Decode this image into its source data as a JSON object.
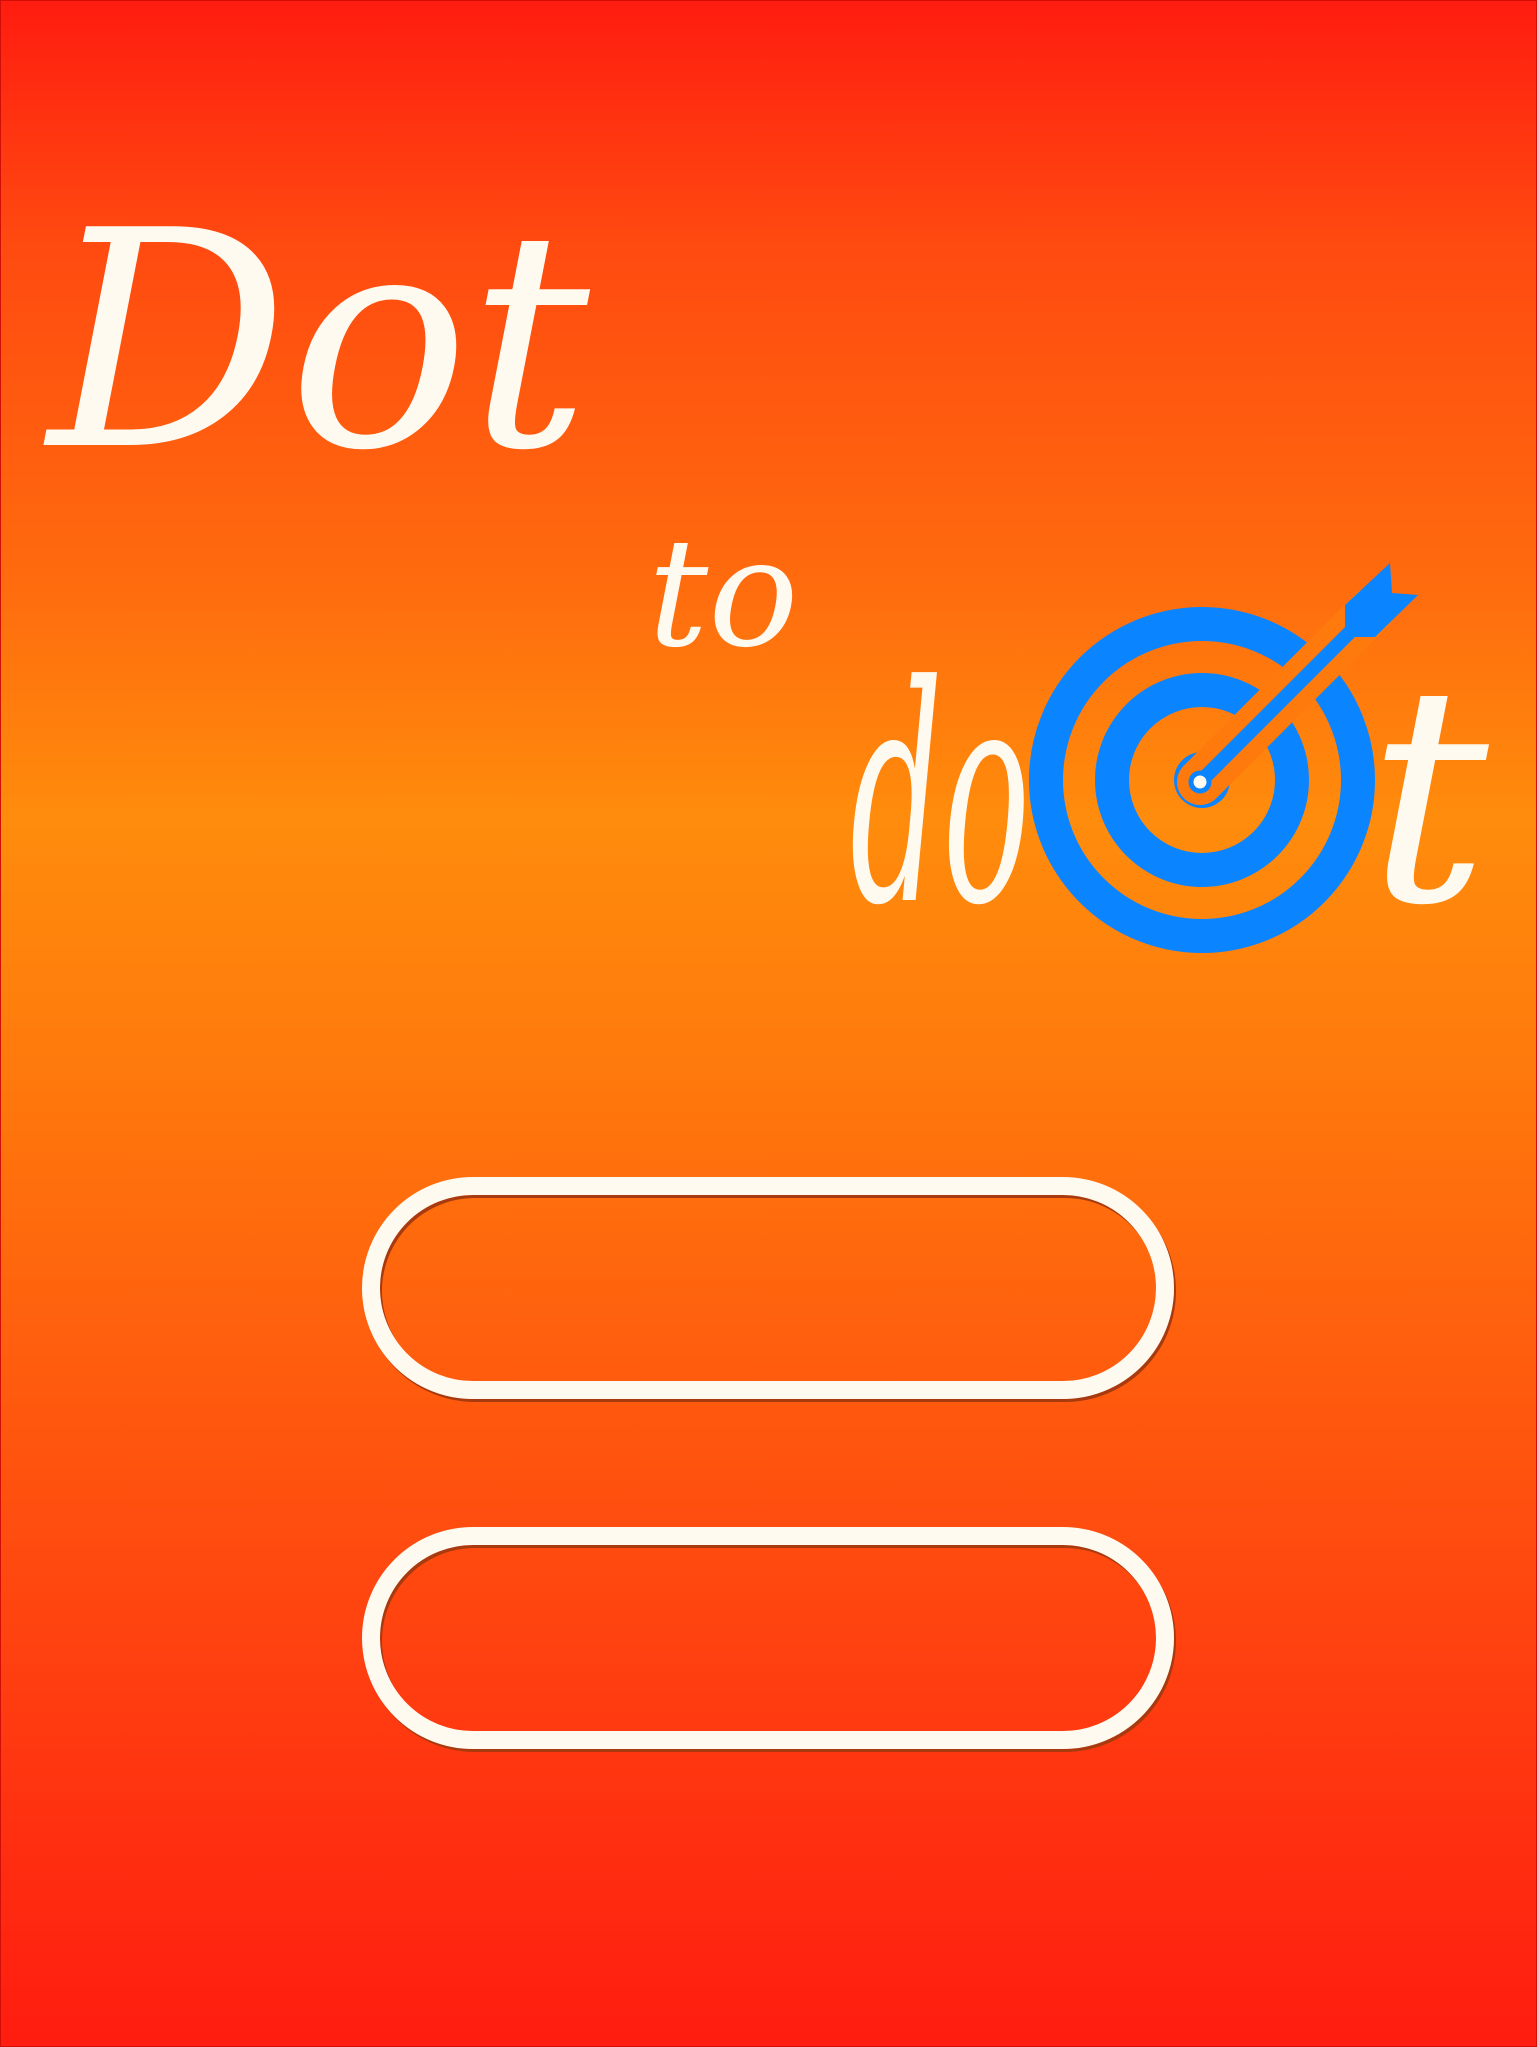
{
  "title": {
    "word_1": "Dot",
    "word_2": "to",
    "word_3": "do",
    "word_3_end": "t"
  },
  "menu": {
    "buttons": [
      {
        "label": ""
      },
      {
        "label": ""
      }
    ]
  },
  "colors": {
    "background_top": "#ff1c10",
    "background_middle": "#ff8c0c",
    "text": "#fffaf0",
    "target": "#0a84ff"
  },
  "icons": {
    "logo_target": "target-with-arrow-icon"
  }
}
